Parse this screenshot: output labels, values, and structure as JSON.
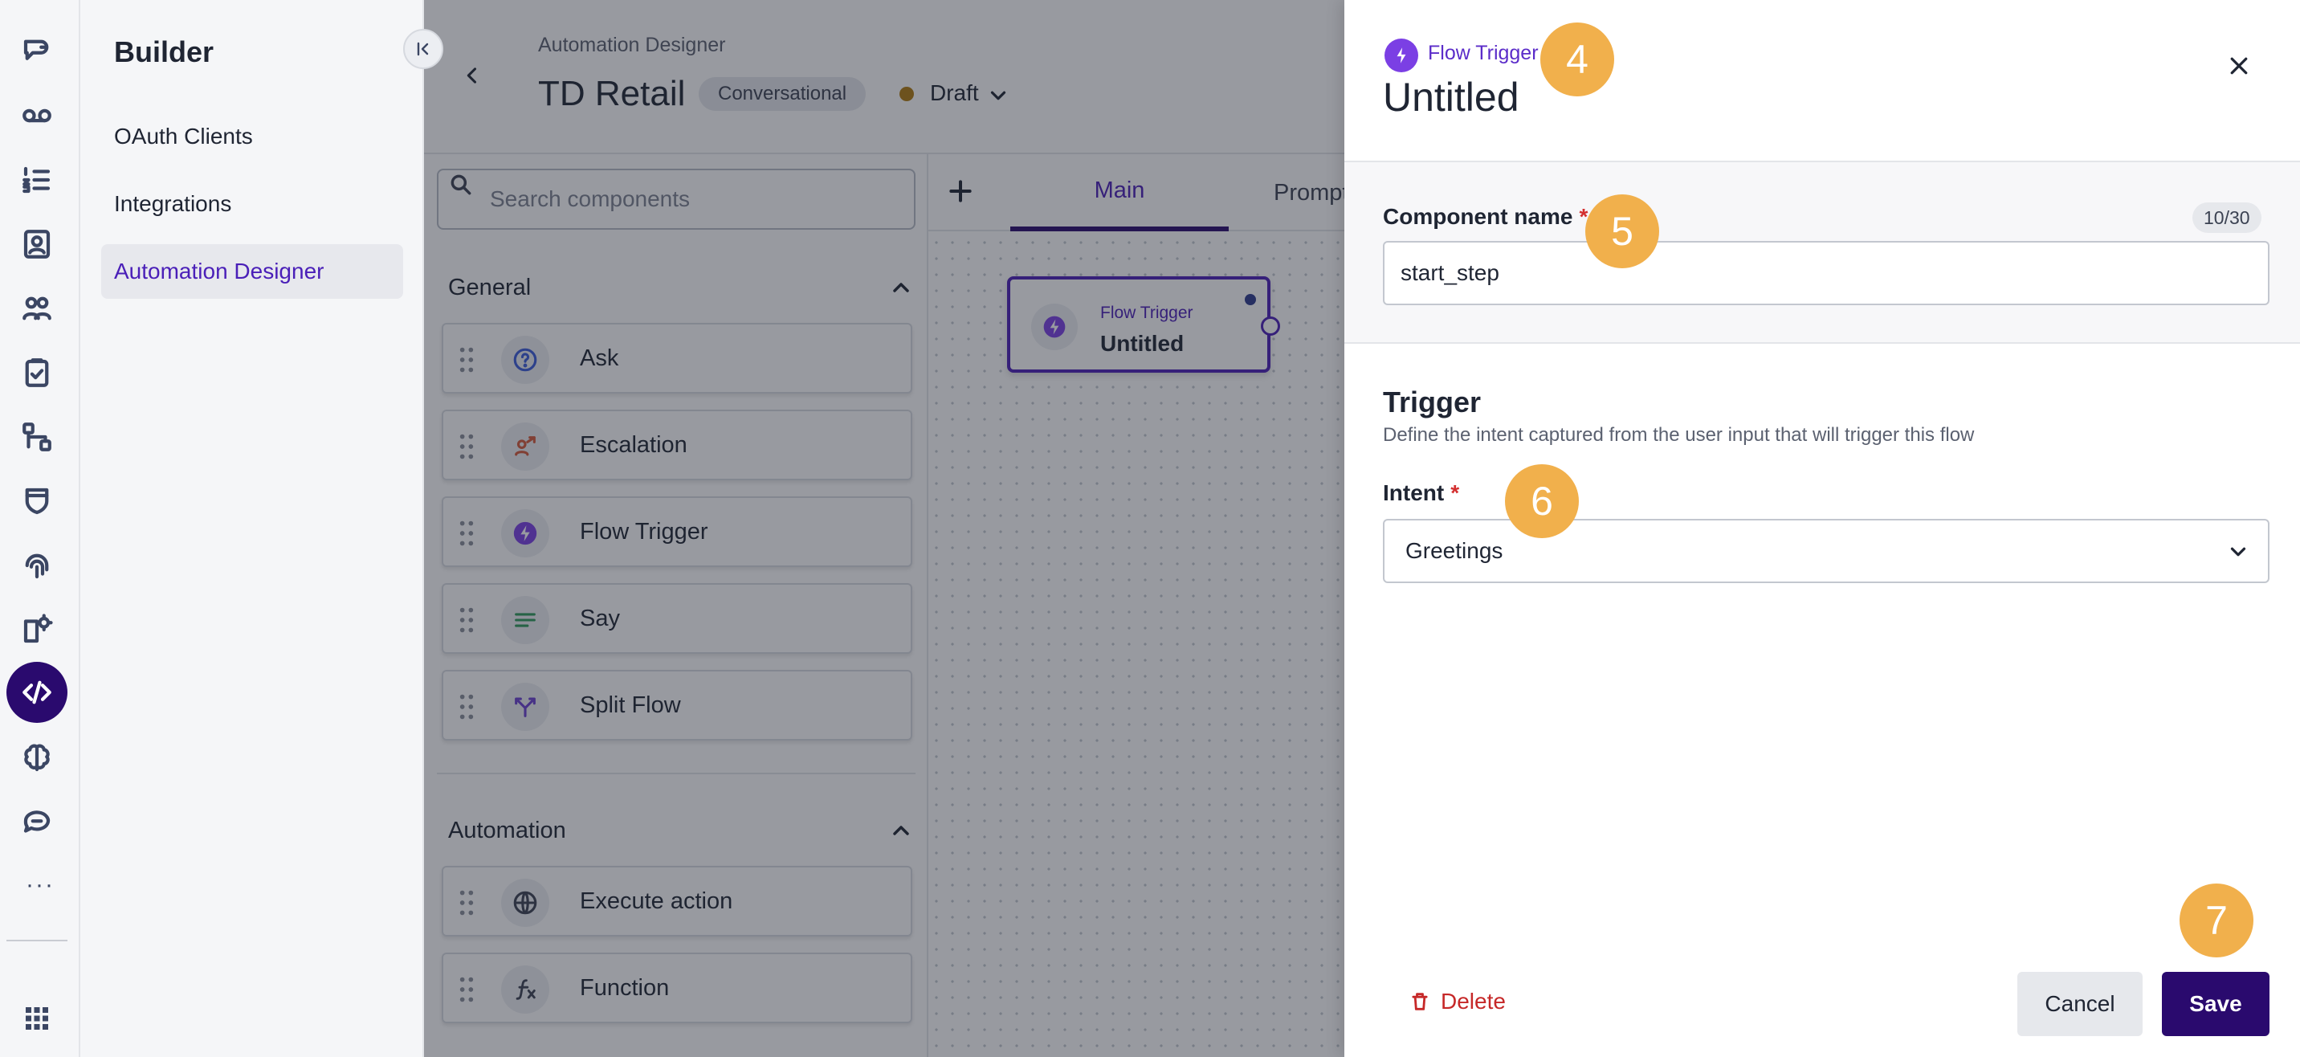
{
  "colors": {
    "accent": "#2a0a6e",
    "accent_text": "#4a1fb8",
    "marker": "#f1b04c",
    "danger": "#c62828",
    "draft": "#b07a10"
  },
  "rail": {
    "icons": [
      "chat-bubble-icon",
      "voicemail-icon",
      "numbered-list-icon",
      "contact-card-icon",
      "people-icon",
      "clipboard-check-icon",
      "flow-icon",
      "shield-icon",
      "fingerprint-icon",
      "settings-gear-icon",
      "code-icon",
      "brain-icon",
      "message-heart-icon",
      "apps-grid-icon"
    ],
    "more_label": "···",
    "active_icon": "code-icon"
  },
  "builder": {
    "title": "Builder",
    "items": [
      {
        "label": "OAuth Clients"
      },
      {
        "label": "Integrations"
      },
      {
        "label": "Automation Designer",
        "active": true
      }
    ]
  },
  "header": {
    "breadcrumb": "Automation Designer",
    "title": "TD Retail",
    "type_badge": "Conversational",
    "status": "Draft"
  },
  "palette": {
    "search_placeholder": "Search components",
    "sections": [
      {
        "title": "General",
        "items": [
          {
            "label": "Ask",
            "icon": "question-circle-icon",
            "color": "#3a5bd9"
          },
          {
            "label": "Escalation",
            "icon": "escalation-icon",
            "color": "#d45a3a"
          },
          {
            "label": "Flow Trigger",
            "icon": "lightning-icon",
            "color": "#7b3fe4"
          },
          {
            "label": "Say",
            "icon": "text-lines-icon",
            "color": "#2e9a5a"
          },
          {
            "label": "Split Flow",
            "icon": "split-icon",
            "color": "#6a3fd0"
          }
        ]
      },
      {
        "title": "Automation",
        "items": [
          {
            "label": "Execute action",
            "icon": "globe-icon",
            "color": "#3b4252"
          },
          {
            "label": "Function",
            "icon": "function-icon",
            "color": "#3b4252"
          }
        ]
      }
    ]
  },
  "tabs": [
    {
      "label": "Main",
      "active": true
    },
    {
      "label": "Prompts"
    }
  ],
  "node": {
    "type": "Flow Trigger",
    "name": "Untitled"
  },
  "drawer": {
    "type_label": "Flow Trigger",
    "title": "Untitled",
    "component_name_label": "Component name",
    "char_count": "10/30",
    "component_name_value": "start_step",
    "trigger_title": "Trigger",
    "trigger_description": "Define the intent captured from the user input that will trigger this flow",
    "intent_label": "Intent",
    "intent_value": "Greetings",
    "delete_label": "Delete",
    "cancel_label": "Cancel",
    "save_label": "Save",
    "required_mark": "*"
  },
  "markers": [
    "4",
    "5",
    "6",
    "7"
  ]
}
